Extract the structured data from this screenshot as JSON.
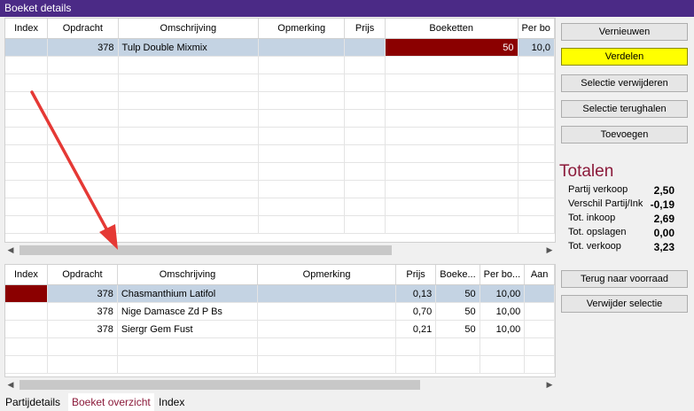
{
  "window": {
    "title": "Boeket details"
  },
  "top_grid": {
    "columns": [
      "Index",
      "Opdracht",
      "Omschrijving",
      "Opmerking",
      "Prijs",
      "Boeketten",
      "Per bo"
    ],
    "rows": [
      {
        "index": "",
        "opdracht": "378",
        "omschrijving": "Tulp Double Mixmix",
        "opmerking": "",
        "prijs": "",
        "boeketten": "50",
        "per_bo": "10,0"
      }
    ]
  },
  "bottom_grid": {
    "columns": [
      "Index",
      "Opdracht",
      "Omschrijving",
      "Opmerking",
      "Prijs",
      "Boeke...",
      "Per bo...",
      "Aan"
    ],
    "rows": [
      {
        "index": "",
        "opdracht": "378",
        "omschrijving": "Chasmanthium Latifol",
        "opmerking": "",
        "prijs": "0,13",
        "boeke": "50",
        "per_bo": "10,00",
        "aan": ""
      },
      {
        "index": "",
        "opdracht": "378",
        "omschrijving": "Nige Damasce Zd P Bs",
        "opmerking": "",
        "prijs": "0,70",
        "boeke": "50",
        "per_bo": "10,00",
        "aan": ""
      },
      {
        "index": "",
        "opdracht": "378",
        "omschrijving": "Siergr Gem Fust",
        "opmerking": "",
        "prijs": "0,21",
        "boeke": "50",
        "per_bo": "10,00",
        "aan": ""
      }
    ]
  },
  "buttons": {
    "vernieuwen": "Vernieuwen",
    "verdelen": "Verdelen",
    "selectie_verwijderen": "Selectie verwijderen",
    "selectie_terughalen": "Selectie terughalen",
    "toevoegen": "Toevoegen",
    "terug_naar_voorraad": "Terug naar voorraad",
    "verwijder_selectie": "Verwijder selectie"
  },
  "totals": {
    "title": "Totalen",
    "items": [
      {
        "label": "Partij verkoop",
        "value": "2,50"
      },
      {
        "label": "Verschil Partij/Ink",
        "value": "-0,19"
      },
      {
        "label": "Tot. inkoop",
        "value": "2,69"
      },
      {
        "label": "Tot. opslagen",
        "value": "0,00"
      },
      {
        "label": "Tot. verkoop",
        "value": "3,23"
      }
    ]
  },
  "tabs": [
    "Partijdetails",
    "Boeket overzicht",
    "Index"
  ],
  "colors": {
    "titlebar": "#4b2a86",
    "highlight_red": "#8b0000",
    "selected_row": "#c4d3e3",
    "accent_yellow": "#ffff00",
    "totals_text": "#8b1a3a",
    "arrow": "#e53935"
  },
  "icons": {
    "scroll_left": "◀",
    "scroll_right": "▶"
  }
}
